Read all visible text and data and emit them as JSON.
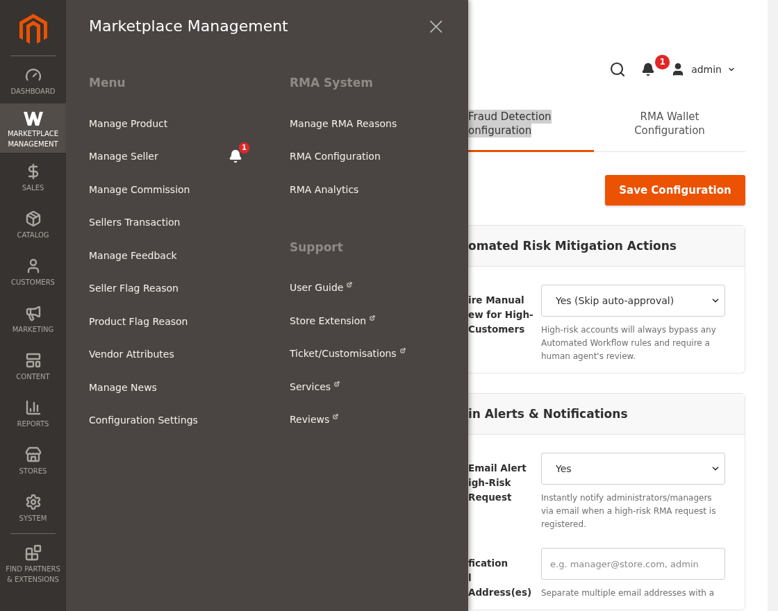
{
  "sidebar": {
    "items": [
      {
        "kind": "dashboard",
        "label": "DASHBOARD",
        "selected": false
      },
      {
        "kind": "marketplace",
        "label": "MARKETPLACE MANAGEMENT",
        "selected": true
      },
      {
        "kind": "sales",
        "label": "SALES",
        "selected": false
      },
      {
        "kind": "catalog",
        "label": "CATALOG",
        "selected": false
      },
      {
        "kind": "customers",
        "label": "CUSTOMERS",
        "selected": false
      },
      {
        "kind": "marketing",
        "label": "MARKETING",
        "selected": false
      },
      {
        "kind": "content",
        "label": "CONTENT",
        "selected": false
      },
      {
        "kind": "reports",
        "label": "REPORTS",
        "selected": false
      },
      {
        "kind": "stores",
        "label": "STORES",
        "selected": false
      },
      {
        "kind": "system",
        "label": "SYSTEM",
        "selected": false
      },
      {
        "kind": "partners",
        "label": "FIND PARTNERS & EXTENSIONS",
        "selected": false
      }
    ]
  },
  "panel": {
    "title": "Marketplace Management",
    "close": "×",
    "columns": [
      {
        "sections": [
          {
            "heading": "Menu",
            "items": [
              {
                "label": "Manage Product",
                "external": false
              },
              {
                "label": "Manage Seller",
                "external": false,
                "badge": "1"
              },
              {
                "label": "Manage Commission",
                "external": false
              },
              {
                "label": "Sellers Transaction",
                "external": false
              },
              {
                "label": "Manage Feedback",
                "external": false
              },
              {
                "label": "Seller Flag Reason",
                "external": false
              },
              {
                "label": "Product Flag Reason",
                "external": false
              },
              {
                "label": "Vendor Attributes",
                "external": false
              },
              {
                "label": "Manage News",
                "external": false
              },
              {
                "label": "Configuration Settings",
                "external": false
              }
            ]
          }
        ]
      },
      {
        "sections": [
          {
            "heading": "RMA System",
            "items": [
              {
                "label": "Manage RMA Reasons",
                "external": false
              },
              {
                "label": "RMA Configuration",
                "external": false
              },
              {
                "label": "RMA Analytics",
                "external": false
              }
            ]
          },
          {
            "heading": "Support",
            "items": [
              {
                "label": "User Guide",
                "external": true
              },
              {
                "label": "Store Extension",
                "external": true
              },
              {
                "label": "Ticket/Customisations",
                "external": true
              },
              {
                "label": "Services",
                "external": true
              },
              {
                "label": "Reviews",
                "external": true
              }
            ]
          }
        ]
      }
    ]
  },
  "header": {
    "notifications": "1",
    "user": "admin"
  },
  "tabs": [
    {
      "lines": [
        "Fraud Detection",
        "onfiguration"
      ],
      "selected": true
    },
    {
      "lines": [
        "RMA Wallet",
        "Configuration"
      ],
      "selected": false
    }
  ],
  "save_button": "Save Configuration",
  "cards": [
    {
      "title": "omated Risk Mitigation Actions",
      "fields": [
        {
          "kind": "select",
          "label_lines": [
            "ire Manual",
            "ew for High-",
            "Customers"
          ],
          "value": "Yes (Skip auto-approval)",
          "hint": "High-risk accounts will always bypass any Automated Workflow rules and require a human agent's review."
        }
      ]
    },
    {
      "title": "in Alerts & Notifications",
      "fields": [
        {
          "kind": "select",
          "label_lines": [
            "Email Alert",
            "igh-Risk",
            "Request"
          ],
          "value": "Yes",
          "hint": "Instantly notify administrators/managers via email when a high-risk RMA request is registered."
        },
        {
          "kind": "text",
          "label_lines": [
            "fication",
            "l",
            "Address(es)"
          ],
          "placeholder": "e.g. manager@store.com, admin",
          "hint": "Separate multiple email addresses with a"
        }
      ]
    }
  ]
}
